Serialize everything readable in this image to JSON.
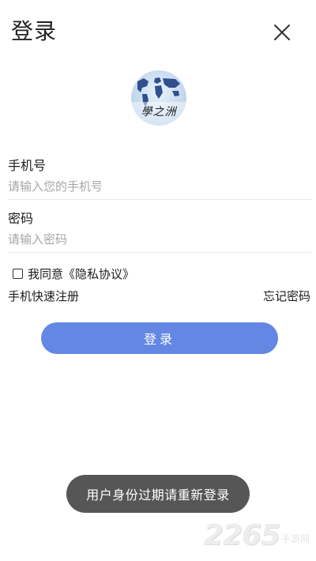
{
  "header": {
    "title": "登录",
    "close_icon": "close-icon"
  },
  "logo": {
    "text": "學之洲",
    "icon": "world-map-icon"
  },
  "form": {
    "phone_label": "手机号",
    "phone_placeholder": "请输入您的手机号",
    "phone_value": "",
    "password_label": "密码",
    "password_placeholder": "请输入密码",
    "password_value": "",
    "agree_text": "我同意《隐私协议》",
    "agree_checked": false,
    "quick_register": "手机快速注册",
    "forgot_password": "忘记密码",
    "login_button": "登录"
  },
  "toast": {
    "message": "用户身份过期请重新登录"
  },
  "watermark": {
    "number": "2265",
    "suffix": "手游网"
  },
  "colors": {
    "accent": "#6387e3",
    "toast_bg": "#565656",
    "divider": "#e8e8e8",
    "placeholder": "#a6a6a6"
  }
}
